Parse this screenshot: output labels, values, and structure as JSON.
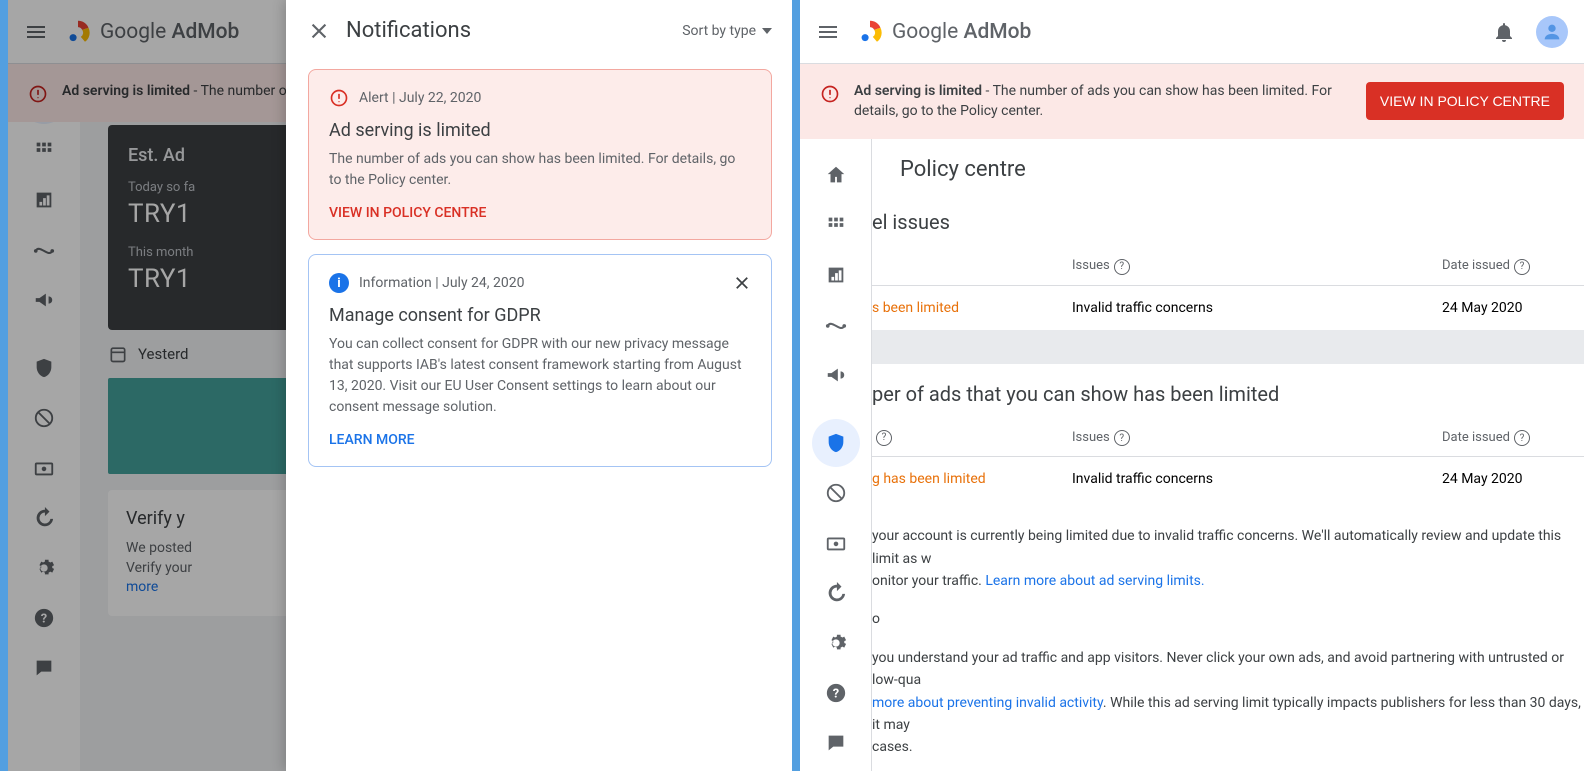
{
  "brand": {
    "google": "Google",
    "product": "AdMob"
  },
  "banner": {
    "bold": "Ad serving is limited",
    "rest": " - The number of ads you can show has been limited. For details, go to the Policy center.",
    "button": "VIEW IN POLICY CENTRE"
  },
  "left": {
    "home": "Home",
    "est_title": "Est. Ad",
    "today_label": "Today so fa",
    "today_value": "TRY1",
    "month_label": "This month",
    "month_value": "TRY1",
    "yesterday": "Yesterd",
    "verify_title": "Verify y",
    "verify_body1": "We posted",
    "verify_body2": "Verify your",
    "verify_more": "more"
  },
  "notif": {
    "title": "Notifications",
    "sort": "Sort by type",
    "alert": {
      "meta": "Alert | July 22, 2020",
      "title": "Ad serving is limited",
      "body": "The number of ads you can show has been limited. For details, go to the Policy center.",
      "action": "VIEW IN POLICY CENTRE"
    },
    "info": {
      "meta": "Information | July 24, 2020",
      "title": "Manage consent for GDPR",
      "body": "You can collect consent for GDPR with our new privacy message that supports IAB's latest consent framework starting from August 13, 2020. Visit our EU User Consent settings to learn about our consent message solution.",
      "action": "LEARN MORE"
    }
  },
  "right": {
    "page_title": "Policy centre",
    "sec1": "el issues",
    "th_issues": "Issues",
    "th_date": "Date issued",
    "row1_status": "s been limited",
    "row1_issue": "Invalid traffic concerns",
    "row1_date": "24 May 2020",
    "sec2": "per of ads that you can show has been limited",
    "row2_status": "g has been limited",
    "row2_issue": "Invalid traffic concerns",
    "row2_date": "24 May 2020",
    "para1a": "your account is currently being limited due to invalid traffic concerns. We'll automatically review and update this limit as w",
    "para1b": "onitor your traffic. ",
    "link1": "Learn more about ad serving limits.",
    "para2": "o",
    "para3a": "you understand your ad traffic and app visitors. Never click your own ads, and avoid partnering with untrusted or low-qua",
    "link2": "more about preventing invalid activity",
    "para3b": ". While this ad serving limit typically impacts publishers for less than 30 days, it may",
    "para3c": "cases."
  }
}
